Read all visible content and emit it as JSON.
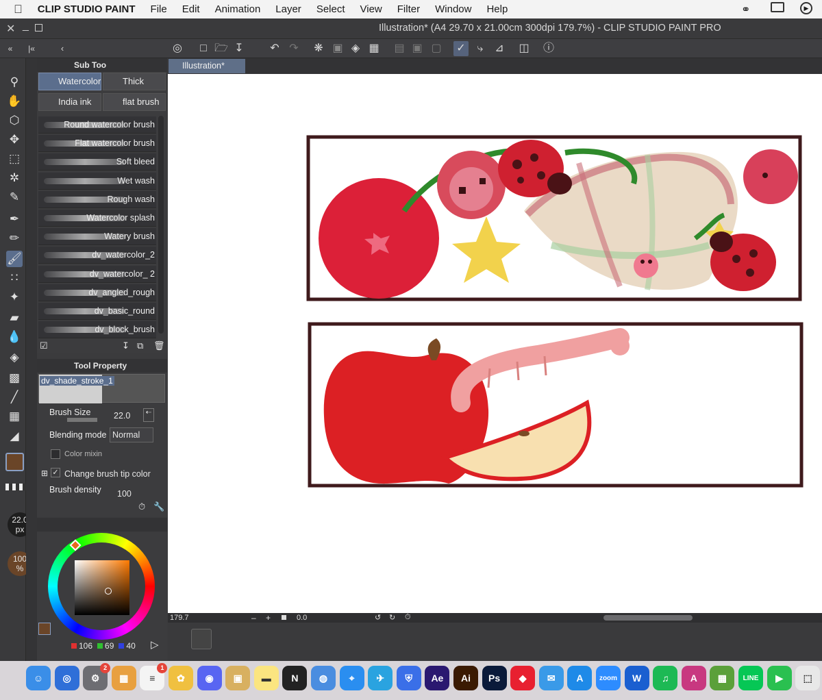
{
  "menubar": {
    "app_name": "CLIP STUDIO PAINT",
    "items": [
      "File",
      "Edit",
      "Animation",
      "Layer",
      "Select",
      "View",
      "Filter",
      "Window",
      "Help"
    ]
  },
  "window": {
    "title": "Illustration* (A4 29.70 x 21.00cm 300dpi 179.7%)  - CLIP STUDIO PAINT PRO"
  },
  "doc_tab": "Illustration*",
  "subtool": {
    "panel_title": "Sub Too",
    "categories": [
      {
        "label": "Watercolor",
        "selected": true
      },
      {
        "label": "Thick paint",
        "selected": false
      },
      {
        "label": "India ink",
        "selected": false
      },
      {
        "label": "flat brush",
        "selected": false
      }
    ],
    "brushes": [
      "Round watercolor brush",
      "Flat watercolor brush",
      "Soft bleed",
      "Wet wash",
      "Rough wash",
      "Watercolor splash",
      "Watery brush",
      "dv_watercolor_2",
      "dv_watercolor_ 2",
      "dv_angled_rough",
      "dv_basic_round",
      "dv_block_brush"
    ]
  },
  "tool_property": {
    "panel_title": "Tool Property",
    "preset_name": "dv_shade_stroke_1",
    "brush_size_label": "Brush Size",
    "brush_size_value": "22.0",
    "blending_label": "Blending mode",
    "blending_value": "Normal",
    "color_mixing_label": "Color mixin",
    "change_tip_label": "Change brush tip color",
    "density_label": "Brush density",
    "density_value": "100"
  },
  "size_indicator": {
    "value": "22.0",
    "unit": "px"
  },
  "opacity_indicator": {
    "value": "100",
    "unit": "%"
  },
  "color": {
    "r": "106",
    "g": "69",
    "b": "40",
    "current_hex": "#6a4528"
  },
  "status": {
    "zoom": "179.7",
    "rotation": "0.0"
  },
  "dock": [
    "Finder",
    "Zoom",
    "System Settings",
    "Launchpad",
    "Reminders",
    "Photos",
    "Discord",
    "Archive",
    "Notes",
    "Notion",
    "Chrome",
    "Safari",
    "Telegram",
    "Bitwarden",
    "Ae",
    "Ai",
    "Ps",
    "Roblox",
    "Mail",
    "App Store",
    "zoom",
    "Word",
    "Spotify",
    "Affinity",
    "Minecraft",
    "LINE",
    "FaceTime",
    "Preview"
  ],
  "dock_badges": {
    "System Settings": "2",
    "Reminders": "1"
  },
  "accent_colors": {
    "selection": "#5b6e8d",
    "frame": "#3f1a1c"
  }
}
